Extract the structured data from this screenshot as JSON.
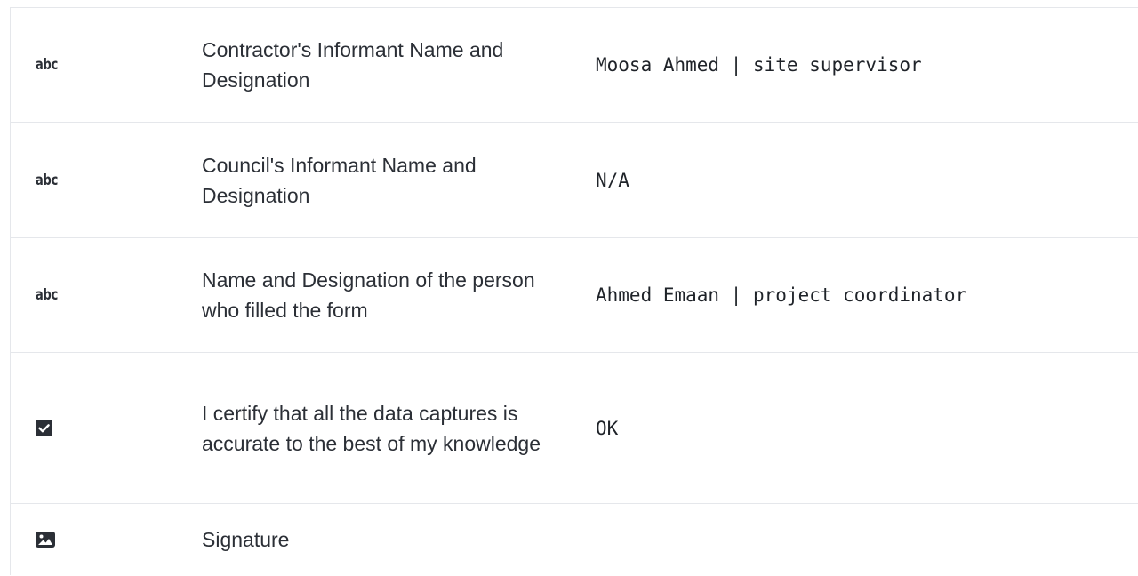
{
  "rows": [
    {
      "type_icon": "abc-text-icon",
      "type_text": "abc",
      "label": "Contractor's Informant Name and Designation",
      "value": "Moosa Ahmed | site supervisor"
    },
    {
      "type_icon": "abc-text-icon",
      "type_text": "abc",
      "label": "Council's Informant Name and Designation",
      "value": "N/A"
    },
    {
      "type_icon": "abc-text-icon",
      "type_text": "abc",
      "label": "Name and Designation of the person who filled the form",
      "value": "Ahmed Emaan | project coordinator"
    },
    {
      "type_icon": "checkbox-checked-icon",
      "label": "I certify that all the data captures is accurate to the best of my knowledge",
      "value": "OK"
    },
    {
      "type_icon": "image-icon",
      "label": "Signature",
      "value": ""
    }
  ]
}
